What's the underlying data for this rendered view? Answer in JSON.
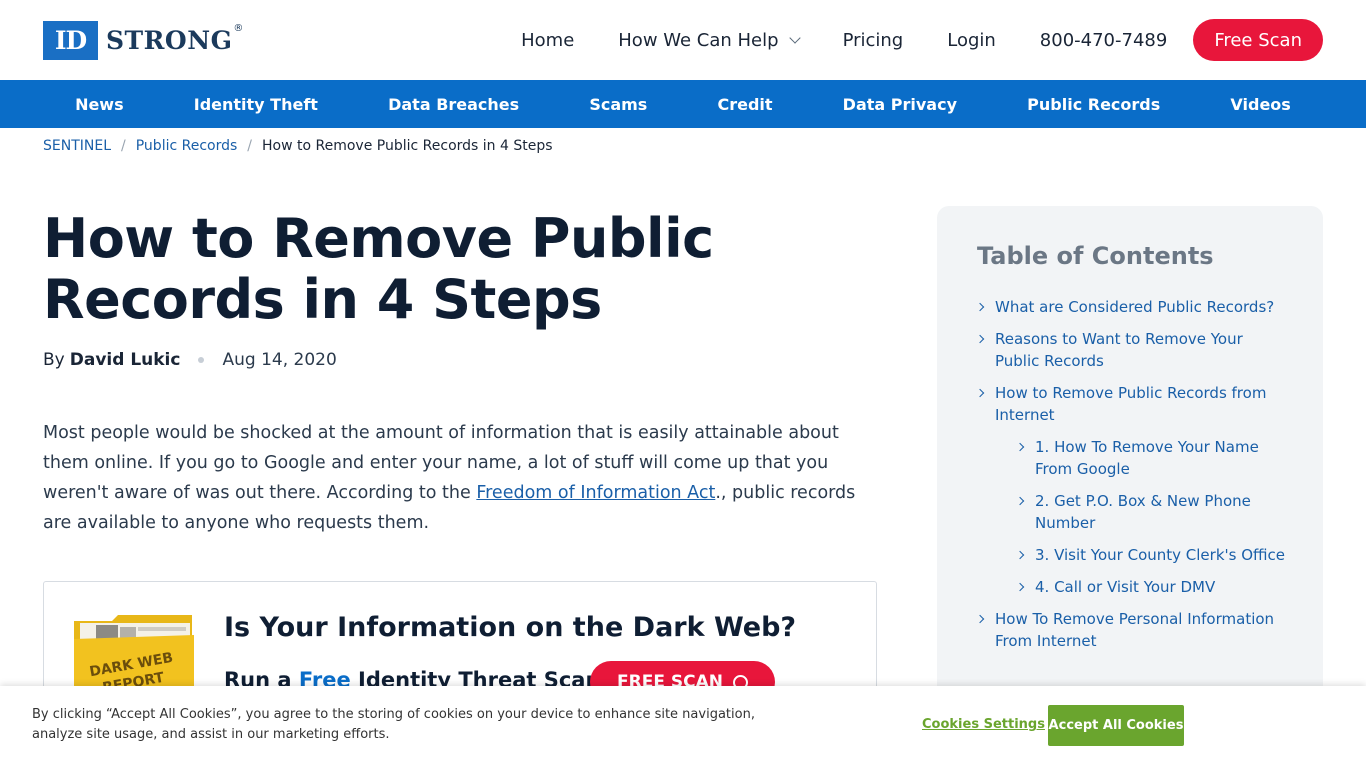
{
  "header": {
    "logo_mark": "ID",
    "logo_word": "STRONG",
    "logo_reg": "®",
    "nav": {
      "home": "Home",
      "help": "How We Can Help",
      "pricing": "Pricing",
      "login": "Login",
      "phone": "800-470-7489",
      "cta": "Free Scan"
    }
  },
  "subnav": [
    "News",
    "Identity Theft",
    "Data Breaches",
    "Scams",
    "Credit",
    "Data Privacy",
    "Public Records",
    "Videos"
  ],
  "breadcrumb": {
    "root": "SENTINEL",
    "sep": "/",
    "section": "Public Records",
    "current": "How to Remove Public Records in 4 Steps"
  },
  "article": {
    "title": "How to Remove Public Records in 4 Steps",
    "by": "By",
    "author": "David Lukic",
    "date": "Aug 14, 2020",
    "intro_before": "Most people would be shocked at the amount of information that is easily attainable about them online. If you go to Google and enter your name, a lot of stuff will come up that you weren't aware of was out there. According to the ",
    "intro_link": "Freedom of Information Act",
    "intro_after": "., public records are available to anyone who requests them."
  },
  "promo": {
    "folder_label_1": "DARK WEB",
    "folder_label_2": "REPORT",
    "title": "Is Your Information on the Dark Web?",
    "sub_before": "Run a ",
    "sub_free": "Free",
    "sub_after": " Identity Threat Scan",
    "button": "FREE SCAN"
  },
  "toc": {
    "title": "Table of Contents",
    "items": [
      {
        "label": "What are Considered Public Records?",
        "sub": false
      },
      {
        "label": "Reasons to Want to Remove Your Public Records",
        "sub": false
      },
      {
        "label": "How to Remove Public Records from Internet",
        "sub": false
      },
      {
        "label": "1. How To Remove Your Name From Google",
        "sub": true
      },
      {
        "label": "2. Get P.O. Box & New Phone Number",
        "sub": true
      },
      {
        "label": "3. Visit Your County Clerk's Office",
        "sub": true
      },
      {
        "label": "4. Call or Visit Your DMV",
        "sub": true
      },
      {
        "label": "How To Remove Personal Information From Internet",
        "sub": false
      }
    ]
  },
  "cookie": {
    "text": "By clicking “Accept All Cookies”, you agree to the storing of cookies on your device to enhance site navigation, analyze site usage, and assist in our marketing efforts.",
    "settings": "Cookies Settings",
    "accept": "Accept All Cookies"
  },
  "colors": {
    "brand_blue": "#0a6dc8",
    "cta_red": "#e8163b",
    "cookie_green": "#6aa52e"
  }
}
